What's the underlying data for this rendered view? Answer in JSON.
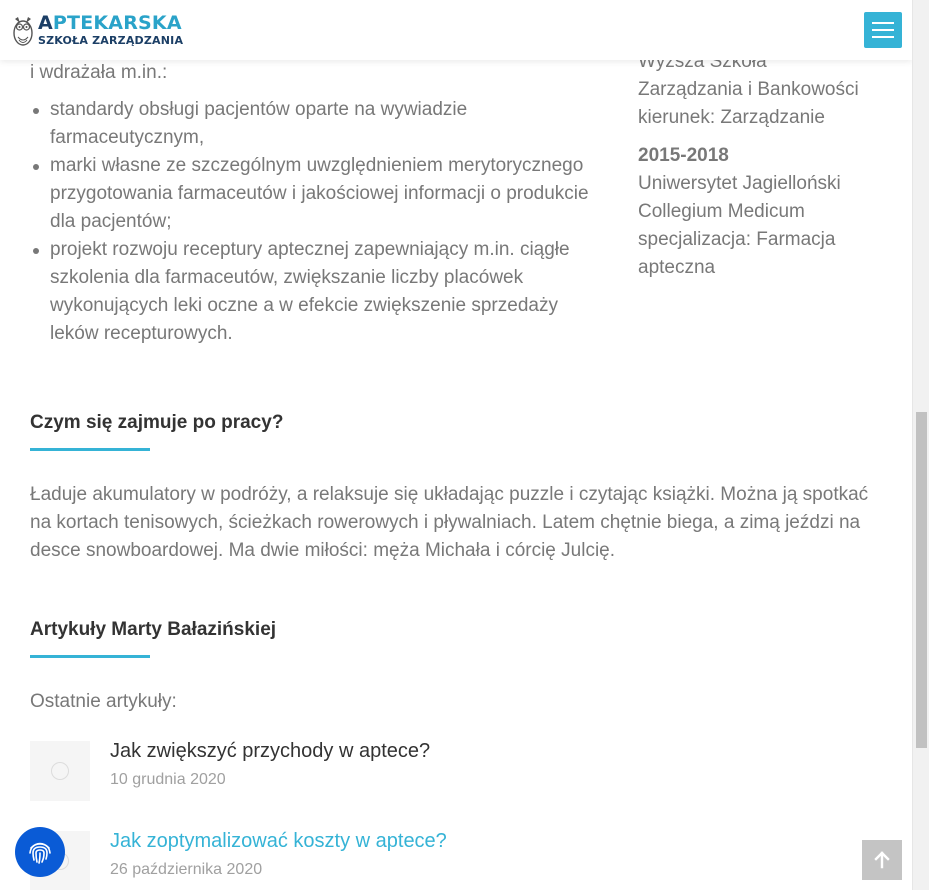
{
  "header": {
    "logo_line1_first": "A",
    "logo_line1_rest": "PTEKARSKA",
    "logo_line2": "SZKOŁA ZARZĄDZANIA",
    "logo_icon": "owl-logo-icon",
    "menu_icon": "hamburger-menu-icon",
    "accent_color": "#35b3d6"
  },
  "career": {
    "intro": "i wdrażała m.in.:",
    "bullets": [
      "standardy obsługi pacjentów oparte na wywiadzie farmaceutycznym,",
      "marki własne ze szczególnym uwzględnieniem merytorycznego przygotowania farmaceutów i jakościowej informacji o produkcie dla pacjentów;",
      "projekt rozwoju receptury aptecznej zapewniający m.in. ciągłe szkolenia dla farmaceutów, zwiększanie liczby placówek wykonujących leki oczne a w efekcie zwiększenie sprzedaży leków recepturowych."
    ]
  },
  "education": {
    "entry1_lines": [
      "Wyższa Szkoła",
      "Zarządzania i Bankowości",
      "kierunek: Zarządzanie"
    ],
    "entry2_year": "2015-2018",
    "entry2_lines": [
      "Uniwersytet Jagielloński",
      "Collegium Medicum",
      "specjalizacja: Farmacja",
      "apteczna"
    ]
  },
  "after_work": {
    "title": "Czym się zajmuje po pracy?",
    "text": "Ładuje akumulatory w podróży, a relaksuje się układając puzzle i czytając książki. Można ją spotkać na kortach tenisowych, ścieżkach rowerowych i pływalniach. Latem chętnie biega, a zimą jeździ na desce snowboardowej. Ma dwie miłości: męża Michała i córcię Julcię."
  },
  "articles": {
    "title": "Artykuły Marty Bałazińskiej",
    "subtitle": "Ostatnie artykuły:",
    "items": [
      {
        "title": "Jak zwiększyć przychody w aptece?",
        "date": "10 grudnia 2020"
      },
      {
        "title": "Jak zoptymalizować koszty w aptece?",
        "date": "26 października 2020"
      }
    ]
  },
  "floating": {
    "fingerprint_icon": "fingerprint-icon",
    "back_to_top_icon": "arrow-up-icon"
  }
}
